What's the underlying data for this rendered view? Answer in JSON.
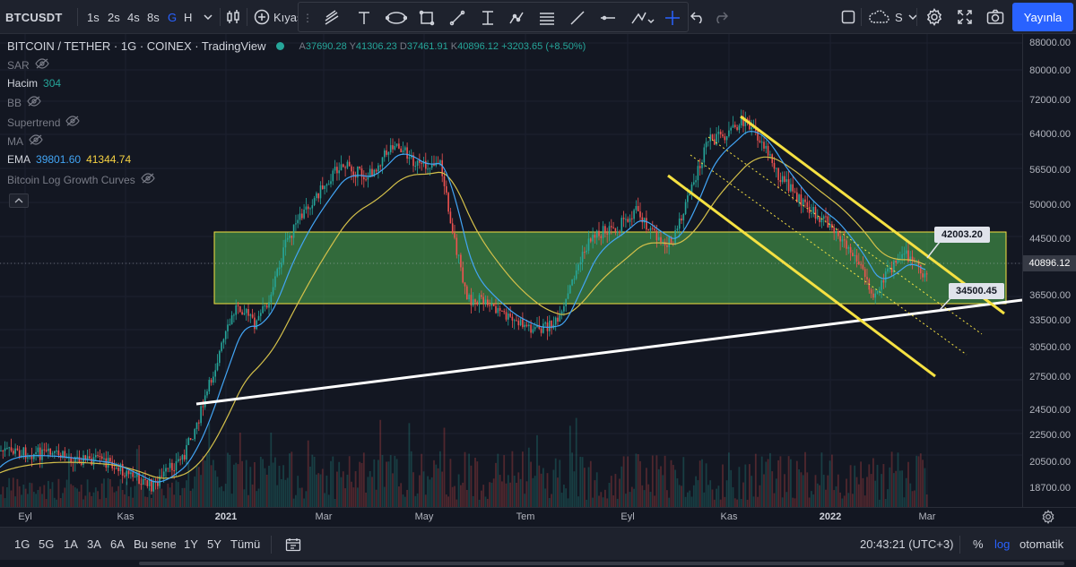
{
  "toolbar": {
    "symbol": "BTCUSDT",
    "intervals": [
      "1s",
      "2s",
      "4s",
      "8s",
      "G",
      "H"
    ],
    "active_interval": "G",
    "compare_label": "Kıyas",
    "publish_label": "Yayınla",
    "layout_label": "S"
  },
  "legend": {
    "title": "BITCOIN / TETHER · 1G · COINEX · TradingView",
    "ohlc": {
      "open_label": "A",
      "open": "37690.28",
      "high_label": "Y",
      "high": "41306.23",
      "low_label": "D",
      "low": "37461.91",
      "close_label": "K",
      "close": "40896.12",
      "change": "+3203.65 (+8.50%)"
    },
    "indicators": [
      {
        "name": "SAR",
        "value": "",
        "hidden": true
      },
      {
        "name": "Hacim",
        "value": "304",
        "hidden": false
      },
      {
        "name": "BB",
        "value": "",
        "hidden": true
      },
      {
        "name": "Supertrend",
        "value": "",
        "hidden": true
      },
      {
        "name": "MA",
        "value": "",
        "hidden": true
      },
      {
        "name": "EMA",
        "value": "39801.60",
        "value2": "41344.74",
        "hidden": false
      },
      {
        "name": "Bitcoin Log Growth Curves",
        "value": "",
        "hidden": true
      }
    ]
  },
  "price_scale": {
    "ticks": [
      "88000.00",
      "80000.00",
      "72000.00",
      "64000.00",
      "56500.00",
      "50000.00",
      "44500.00",
      "36500.00",
      "33500.00",
      "30500.00",
      "27500.00",
      "24500.00",
      "22500.00",
      "20500.00",
      "18700.00"
    ],
    "current": "40896.12",
    "current_color": "#363a45"
  },
  "time_scale": {
    "ticks": [
      {
        "label": "Eyl",
        "bold": false
      },
      {
        "label": "Kas",
        "bold": false
      },
      {
        "label": "2021",
        "bold": true
      },
      {
        "label": "Mar",
        "bold": false
      },
      {
        "label": "May",
        "bold": false
      },
      {
        "label": "Tem",
        "bold": false
      },
      {
        "label": "Eyl",
        "bold": false
      },
      {
        "label": "Kas",
        "bold": false
      },
      {
        "label": "2022",
        "bold": true
      },
      {
        "label": "Mar",
        "bold": false
      }
    ]
  },
  "annotations": {
    "upper_price": "42003.20",
    "lower_price": "34500.45"
  },
  "bottombar": {
    "ranges": [
      "1G",
      "5G",
      "1A",
      "3A",
      "6A",
      "Bu sene",
      "1Y",
      "5Y",
      "Tümü"
    ],
    "clock": "20:43:21 (UTC+3)",
    "percent_label": "%",
    "log_label": "log",
    "auto_label": "otomatik"
  },
  "colors": {
    "background": "#131722",
    "up_candle": "#26a69a",
    "down_candle": "#ef5350",
    "zone_fill": "#4caf50",
    "channel": "#f5e142",
    "trendline": "#ffffff",
    "ema_fast": "#42a5f5",
    "ema_slow": "#d4c04a",
    "accent": "#2962ff"
  }
}
